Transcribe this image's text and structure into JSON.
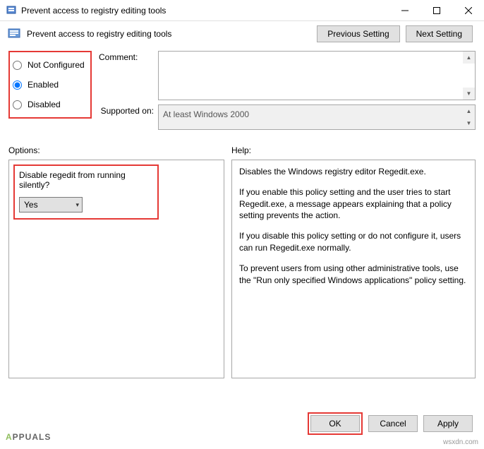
{
  "window": {
    "title": "Prevent access to registry editing tools"
  },
  "header": {
    "title": "Prevent access to registry editing tools",
    "previous": "Previous Setting",
    "next": "Next Setting"
  },
  "state": {
    "not_configured": "Not Configured",
    "enabled": "Enabled",
    "disabled": "Disabled",
    "selected": "enabled"
  },
  "comment": {
    "label": "Comment:",
    "value": ""
  },
  "supported": {
    "label": "Supported on:",
    "value": "At least Windows 2000"
  },
  "labels": {
    "options": "Options:",
    "help": "Help:"
  },
  "options": {
    "question": "Disable regedit from running silently?",
    "value": "Yes"
  },
  "help": {
    "p1": "Disables the Windows registry editor Regedit.exe.",
    "p2": "If you enable this policy setting and the user tries to start Regedit.exe, a message appears explaining that a policy setting prevents the action.",
    "p3": "If you disable this policy setting or do not configure it, users can run Regedit.exe normally.",
    "p4": "To prevent users from using other administrative tools, use the \"Run only specified Windows applications\" policy setting."
  },
  "footer": {
    "ok": "OK",
    "cancel": "Cancel",
    "apply": "Apply"
  },
  "watermark": {
    "text": "PPUALS",
    "letter": "A",
    "credit": "wsxdn.com"
  }
}
